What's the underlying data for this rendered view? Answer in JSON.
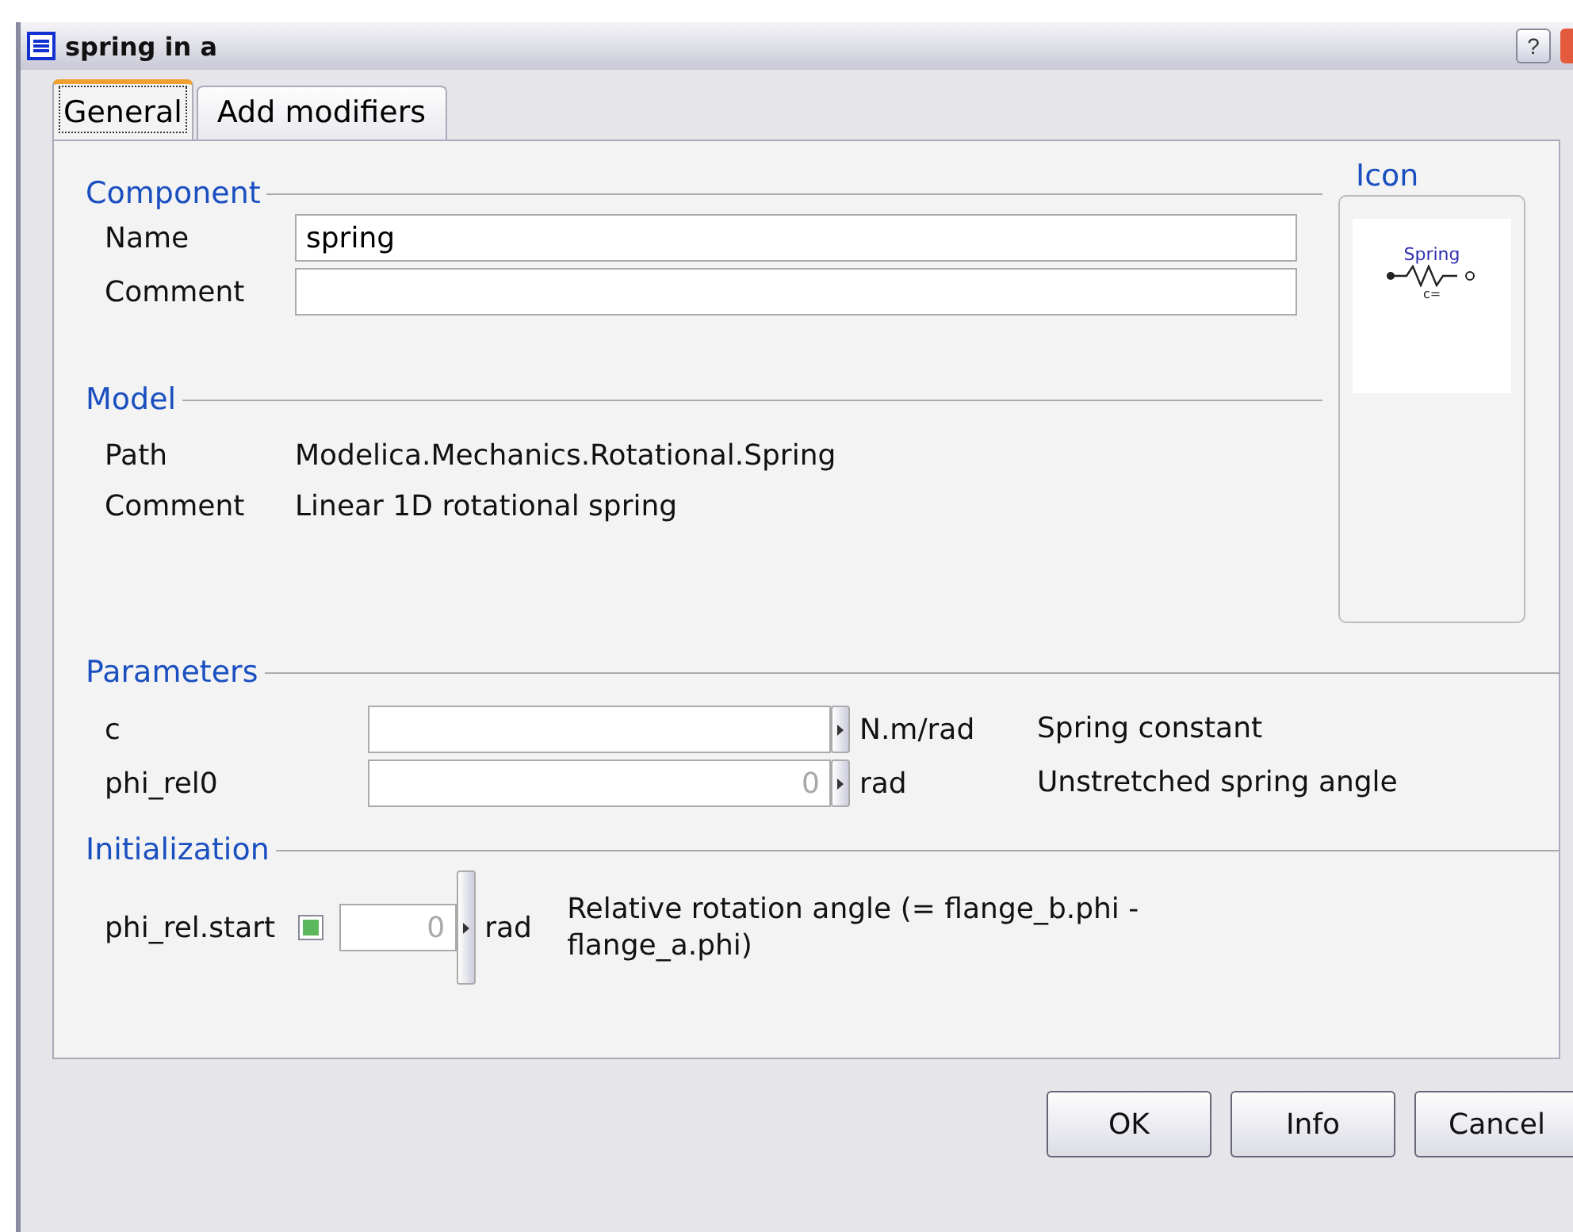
{
  "window": {
    "title": "spring in a",
    "buttons": [
      {
        "kind": "help",
        "label": "?"
      }
    ]
  },
  "tabs": [
    {
      "label": "General",
      "selected": true
    },
    {
      "label": "Add modifiers",
      "selected": false
    }
  ],
  "component": {
    "heading": "Component",
    "fields": [
      {
        "label": "Name",
        "value": "spring"
      },
      {
        "label": "Comment"
      }
    ]
  },
  "icon": {
    "heading": "Icon",
    "caption": "Spring",
    "sublabel": "c="
  },
  "model": {
    "heading": "Model",
    "rows": [
      {
        "label": "Path",
        "value": "Modelica.Mechanics.Rotational.Spring"
      },
      {
        "label": "Comment",
        "value": "Linear 1D rotational spring"
      }
    ]
  },
  "parameters": {
    "heading": "Parameters",
    "rows": [
      {
        "name": "c",
        "placeholder": "",
        "unit": "N.m/rad",
        "description": "Spring constant"
      },
      {
        "name": "phi_rel0",
        "placeholder": "0",
        "unit": "rad",
        "description": "Unstretched spring angle"
      }
    ]
  },
  "initialization": {
    "heading": "Initialization",
    "rows": [
      {
        "name": "phi_rel.start",
        "checked": true,
        "placeholder": "0",
        "unit": "rad",
        "description": "Relative rotation angle (= flange_b.phi - flange_a.phi)"
      }
    ]
  },
  "buttons": [
    "OK",
    "Info",
    "Cancel"
  ]
}
